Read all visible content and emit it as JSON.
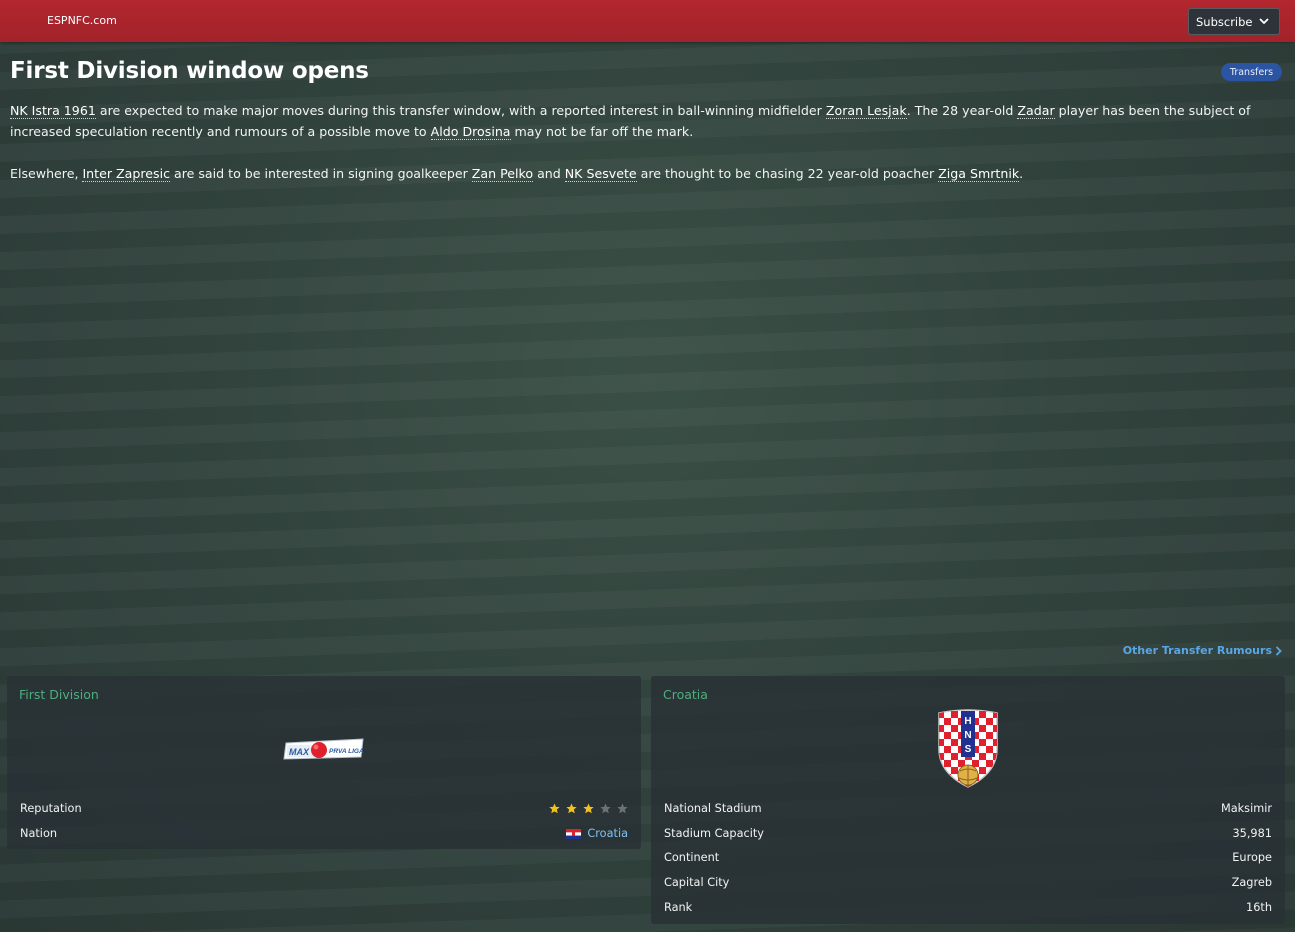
{
  "header": {
    "brand": "ESPNFC.com",
    "subscribe_label": "Subscribe"
  },
  "article": {
    "title": "First Division window opens",
    "tag": "Transfers",
    "p1": {
      "link1": "NK Istra 1961",
      "t1": " are expected to make major moves during this transfer window, with a reported interest in ball-winning midfielder ",
      "link2": "Zoran Lesjak",
      "t2": ". The 28 year-old ",
      "link3": "Zadar",
      "t3": " player has been the subject of increased speculation recently and rumours of a possible move to ",
      "link4": "Aldo Drosina",
      "t4": " may not be far off the mark."
    },
    "p2": {
      "t0": "Elsewhere, ",
      "link1": "Inter Zapresic",
      "t1": " are said to be interested in signing goalkeeper ",
      "link2": "Zan Pelko",
      "t2": " and ",
      "link3": "NK Sesvete",
      "t3": " are thought to be chasing 22 year-old poacher ",
      "link4": "Ziga Smrtnik",
      "t4": "."
    },
    "more_link": "Other Transfer Rumours"
  },
  "league_panel": {
    "title": "First Division",
    "logo_text_left": "MAX",
    "logo_text_right": "PRVA LIGA",
    "rows": [
      {
        "label": "Reputation",
        "rating": 3,
        "rating_max": 5
      },
      {
        "label": "Nation",
        "value": "Croatia"
      }
    ]
  },
  "nation_panel": {
    "title": "Croatia",
    "crest_letters": [
      "H",
      "N",
      "S"
    ],
    "rows": [
      {
        "label": "National Stadium",
        "value": "Maksimir"
      },
      {
        "label": "Stadium Capacity",
        "value": "35,981"
      },
      {
        "label": "Continent",
        "value": "Europe"
      },
      {
        "label": "Capital City",
        "value": "Zagreb"
      },
      {
        "label": "Rank",
        "value": "16th"
      }
    ]
  },
  "colors": {
    "header_red": "#b3262e",
    "accent_green": "#4fae7e",
    "link_blue": "#5aa6e4",
    "tag_blue": "#2b55a2",
    "star_gold": "#f2c21b"
  }
}
